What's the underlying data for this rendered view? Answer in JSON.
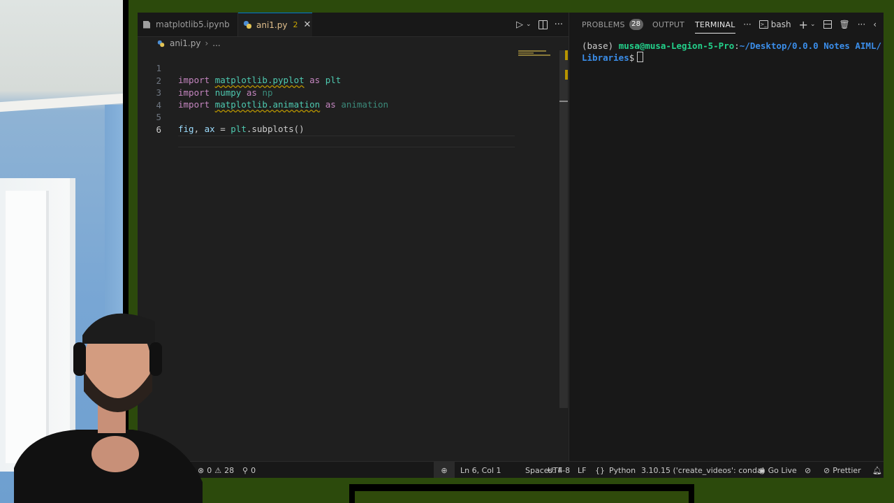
{
  "editor": {
    "tabs": [
      {
        "label": "matplotlib5.ipynb"
      },
      {
        "label": "ani1.py",
        "problems": "2"
      }
    ],
    "breadcrumb": {
      "file": "ani1.py",
      "more": "..."
    },
    "code_lines": [
      {
        "number": "1",
        "parts": [
          "import",
          "matplotlib.pyplot",
          "as",
          "plt"
        ]
      },
      {
        "number": "2",
        "parts": [
          "import",
          "numpy",
          "as",
          "np"
        ]
      },
      {
        "number": "3",
        "parts": [
          "import",
          "matplotlib.animation",
          "as",
          "animation"
        ]
      },
      {
        "number": "4",
        "parts": []
      },
      {
        "number": "5",
        "parts": [
          "fig",
          ", ",
          "ax",
          " = ",
          "plt",
          ".subplots()"
        ]
      },
      {
        "number": "6",
        "parts": []
      }
    ]
  },
  "panel": {
    "tabs": {
      "problems": "PROBLEMS",
      "problems_count": "28",
      "output": "OUTPUT",
      "terminal": "TERMINAL"
    },
    "shell": "bash",
    "terminal": {
      "prefix": "(base) ",
      "user_host": "musa@musa-Legion-5-Pro",
      "sep": ":",
      "path_line1": "~/Desktop/0.0.0 Notes AIML/",
      "path_line2": "Libraries",
      "prompt": "$"
    }
  },
  "statusbar": {
    "errors": "0",
    "warnings": "28",
    "ports": "0",
    "position": "Ln 6, Col 1",
    "spaces": "Spaces: 4",
    "encoding": "UTF-8",
    "eol": "LF",
    "language": "Python",
    "interpreter": "3.10.15 ('create_videos': conda)",
    "go_live": "Go Live",
    "prettier": "Prettier"
  }
}
